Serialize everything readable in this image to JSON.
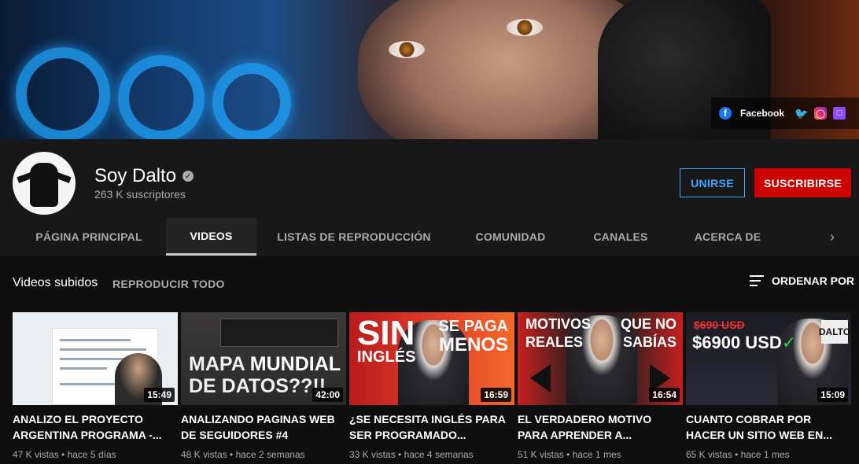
{
  "banner": {
    "social": {
      "facebook_label": "Facebook",
      "links": [
        "facebook-icon",
        "twitter-icon",
        "instagram-icon",
        "twitch-icon"
      ]
    }
  },
  "channel": {
    "name": "Soy Dalto",
    "subscribers": "263 K suscriptores",
    "join_label": "UNIRSE",
    "subscribe_label": "SUSCRIBIRSE",
    "colors": {
      "subscribe": "#cc0000",
      "join": "#3ea6ff"
    }
  },
  "tabs": [
    {
      "label": "PÁGINA PRINCIPAL",
      "active": false
    },
    {
      "label": "VIDEOS",
      "active": true
    },
    {
      "label": "LISTAS DE REPRODUCCIÓN",
      "active": false
    },
    {
      "label": "COMUNIDAD",
      "active": false
    },
    {
      "label": "CANALES",
      "active": false
    },
    {
      "label": "ACERCA DE",
      "active": false
    }
  ],
  "section": {
    "title": "Videos subidos",
    "play_all": "REPRODUCIR TODO",
    "sort_label": "ORDENAR POR"
  },
  "videos": [
    {
      "title": "ANALIZO EL PROYECTO ARGENTINA PROGRAMA -...",
      "duration": "15:49",
      "views": "47 K vistas",
      "age": "hace 5 días"
    },
    {
      "title": "ANALIZANDO PAGINAS WEB DE SEGUIDORES #4",
      "duration": "42:00",
      "views": "48 K vistas",
      "age": "hace 2 semanas",
      "thumb_text": [
        "MAPA",
        "MUNDIAL",
        "DE DATOS??!!"
      ]
    },
    {
      "title": "¿SE NECESITA INGLÉS PARA SER PROGRAMADO...",
      "duration": "16:59",
      "views": "33 K vistas",
      "age": "hace 4 semanas",
      "thumb_text": [
        "SIN",
        "INGLÉS",
        "SE PAGA",
        "MENOS"
      ]
    },
    {
      "title": "EL VERDADERO MOTIVO PARA APRENDER A...",
      "duration": "16:54",
      "views": "51 K vistas",
      "age": "hace 1 mes",
      "thumb_text": [
        "MOTIVOS",
        "REALES",
        "QUE NO",
        "SABÍAS"
      ]
    },
    {
      "title": "CUANTO COBRAR POR HACER UN SITIO WEB EN...",
      "duration": "15:09",
      "views": "65 K vistas",
      "age": "hace 1 mes",
      "thumb_text": [
        "$690 USD",
        "$6900 USD",
        "DALTO"
      ]
    }
  ]
}
